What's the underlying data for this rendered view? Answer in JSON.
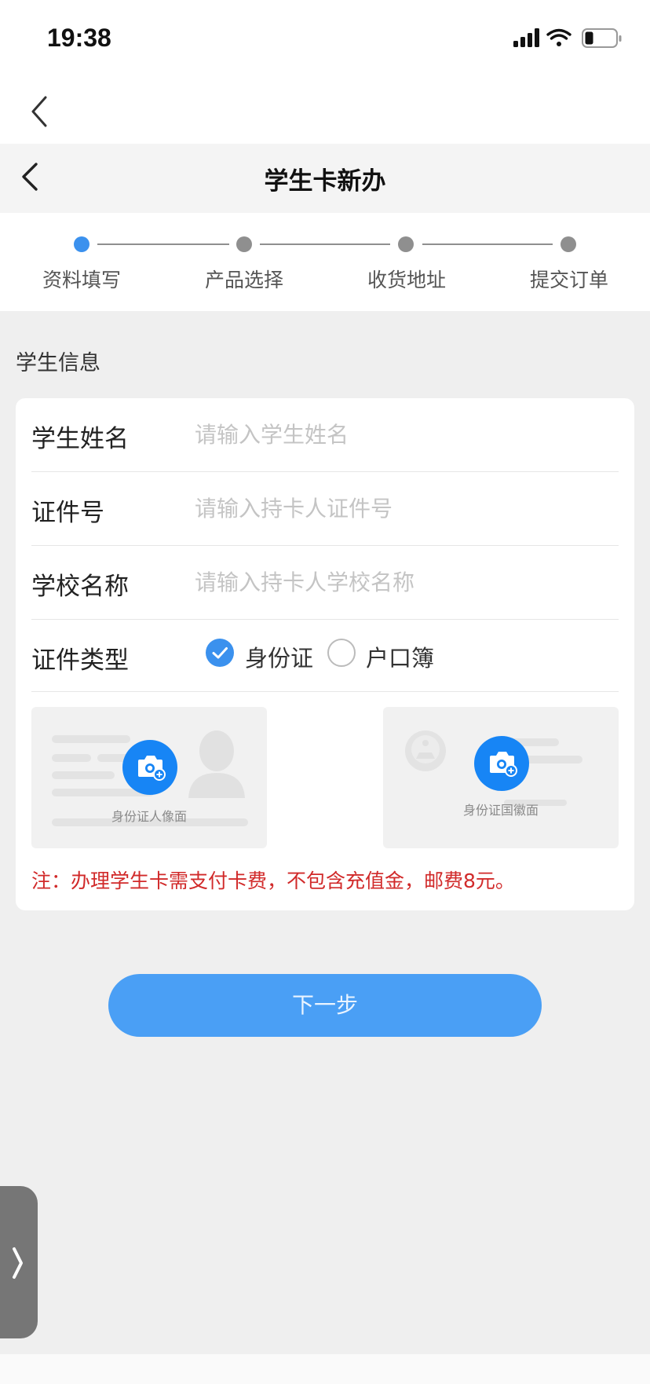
{
  "status_bar": {
    "time": "19:38",
    "icons": [
      "cellular-signal-icon",
      "wifi-icon",
      "battery-icon"
    ]
  },
  "nav": {
    "back_icon": "chevron-left-icon"
  },
  "header": {
    "title": "学生卡新办",
    "back_icon": "chevron-left-icon"
  },
  "steps": [
    {
      "label": "资料填写",
      "active": true
    },
    {
      "label": "产品选择",
      "active": false
    },
    {
      "label": "收货地址",
      "active": false
    },
    {
      "label": "提交订单",
      "active": false
    }
  ],
  "section_title": "学生信息",
  "form": {
    "name": {
      "label": "学生姓名",
      "placeholder": "请输入学生姓名",
      "value": ""
    },
    "id_number": {
      "label": "证件号",
      "placeholder": "请输入持卡人证件号",
      "value": ""
    },
    "school": {
      "label": "学校名称",
      "placeholder": "请输入持卡人学校名称",
      "value": ""
    },
    "id_type": {
      "label": "证件类型",
      "options": [
        {
          "label": "身份证",
          "checked": true
        },
        {
          "label": "户口簿",
          "checked": false
        }
      ]
    }
  },
  "uploads": {
    "front": {
      "label": "身份证人像面",
      "icon": "camera-add-icon"
    },
    "back": {
      "label": "身份证国徽面",
      "icon": "camera-add-icon"
    }
  },
  "note": "注：办理学生卡需支付卡费，不包含充值金，邮费8元。",
  "next_button": "下一步",
  "side_tab": {
    "icon": "chevron-right-icon"
  },
  "colors": {
    "accent": "#3b91ee",
    "button": "#4a9ff5",
    "camera": "#1785f5",
    "note": "#d12a2a",
    "background": "#efefef"
  }
}
